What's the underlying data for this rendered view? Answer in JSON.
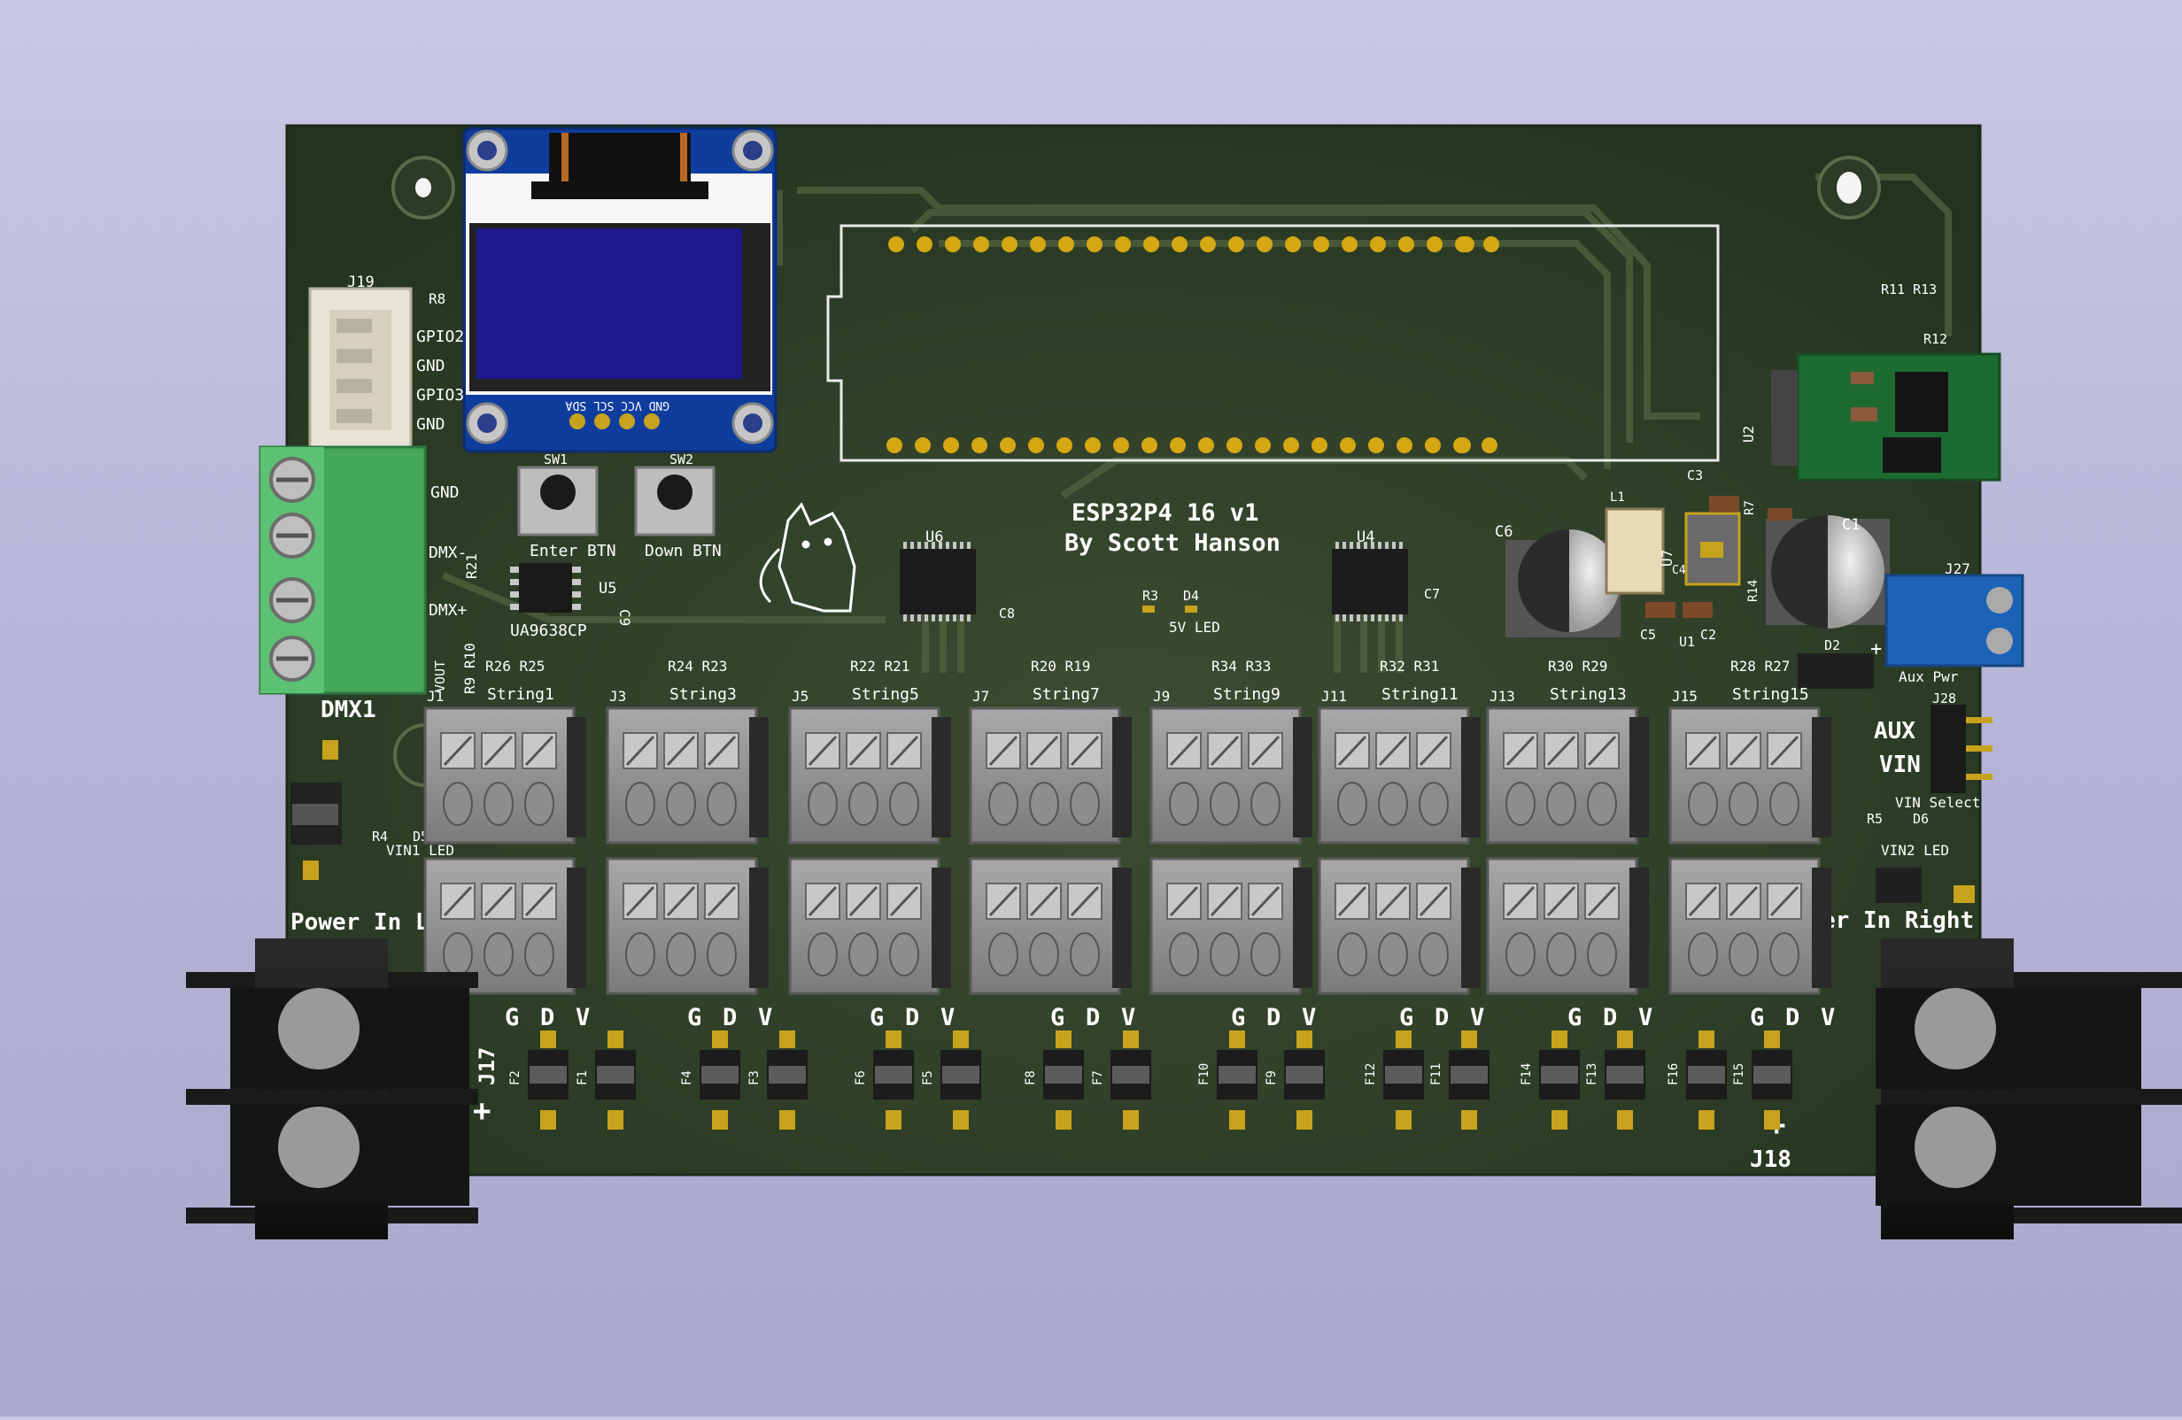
{
  "board": {
    "title": "ESP32P4 16 v1",
    "author": "By Scott Hanson"
  },
  "connectors": {
    "j19": {
      "ref": "J19",
      "pins": [
        "GPIO2",
        "GND",
        "GPIO3",
        "GND"
      ]
    },
    "dmx": {
      "ref": "DMX1",
      "pins": [
        "GND",
        "DMX-",
        "DMX+"
      ]
    },
    "oled_pins": "GND VCC SCL SDA",
    "aux": {
      "ref": "J27",
      "label": "Aux Pwr"
    },
    "j28": {
      "ref": "J28",
      "label": "VIN Select",
      "aux": "AUX",
      "vin": "VIN"
    },
    "power_left": {
      "ref": "J17",
      "label": "Power In Left"
    },
    "power_right": {
      "ref": "J18",
      "label": "Power In Right"
    }
  },
  "buttons": [
    {
      "ref": "SW1",
      "label": "Enter BTN"
    },
    {
      "ref": "SW2",
      "label": "Down BTN"
    }
  ],
  "leds": [
    {
      "ref": "D4",
      "label": "5V LED"
    },
    {
      "ref": "D5",
      "label": "VIN1 LED"
    },
    {
      "ref": "D6",
      "label": "VIN2 LED"
    }
  ],
  "ics": [
    "U2",
    "U4",
    "U5",
    "U6",
    "U7",
    "U1"
  ],
  "ic_labels": {
    "u5_part": "UA9638CP"
  },
  "top_strings": [
    {
      "ref": "J1",
      "label": "String1",
      "res": "R26 R25"
    },
    {
      "ref": "J3",
      "label": "String3",
      "res": "R24 R23"
    },
    {
      "ref": "J5",
      "label": "String5",
      "res": "R22 R21"
    },
    {
      "ref": "J7",
      "label": "String7",
      "res": "R20   R19"
    },
    {
      "ref": "J9",
      "label": "String9",
      "res": "R34 R33"
    },
    {
      "ref": "J11",
      "label": "String11",
      "res": "R32 R31"
    },
    {
      "ref": "J13",
      "label": "String13",
      "res": "R30 R29"
    },
    {
      "ref": "J15",
      "label": "String15",
      "res": "R28 R27"
    }
  ],
  "gdv": [
    "G",
    "D",
    "V"
  ],
  "fuses": [
    "F2",
    "F1",
    "F4",
    "F3",
    "F6",
    "F5",
    "F8",
    "F7",
    "F10",
    "F9",
    "F12",
    "F11",
    "F14",
    "F13",
    "F16",
    "F15"
  ],
  "misc": {
    "r8": "R8",
    "r21": "R21",
    "r9r10": "R9 R10",
    "vout": "VOUT",
    "r4": "R4",
    "d5": "D5",
    "r3": "R3",
    "d4": "D4",
    "c8": "C8",
    "c7": "C7",
    "c6": "C6",
    "c1": "C1",
    "c3": "C3",
    "c5": "C5",
    "c2": "C2",
    "c4": "C4",
    "c9": "C9",
    "d2": "D2",
    "r5": "R5",
    "d6": "D6",
    "r11r13": "R11 R13",
    "r12": "R12",
    "r7": "R7",
    "r14": "R14",
    "l1": "L1",
    "j17tag": "J17",
    "plus": "+",
    "minus": "-"
  }
}
